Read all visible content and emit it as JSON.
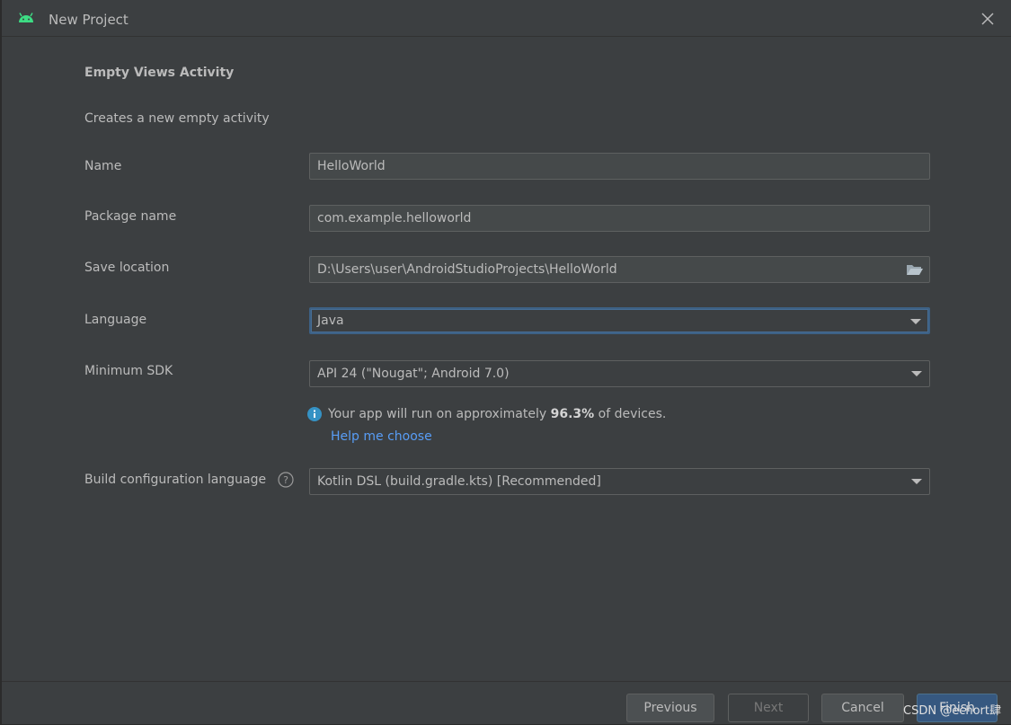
{
  "window": {
    "title": "New Project"
  },
  "template": {
    "heading": "Empty Views Activity",
    "description": "Creates a new empty activity"
  },
  "form": {
    "name": {
      "label": "Name",
      "value": "HelloWorld"
    },
    "package": {
      "label": "Package name",
      "value": "com.example.helloworld"
    },
    "location": {
      "label": "Save location",
      "value": "D:\\Users\\user\\AndroidStudioProjects\\HelloWorld"
    },
    "language": {
      "label": "Language",
      "value": "Java"
    },
    "min_sdk": {
      "label": "Minimum SDK",
      "value": "API 24 (\"Nougat\"; Android 7.0)"
    },
    "build_config": {
      "label": "Build configuration language",
      "value": "Kotlin DSL (build.gradle.kts) [Recommended]"
    }
  },
  "info": {
    "prefix": "Your app will run on approximately ",
    "percent": "96.3%",
    "suffix": " of devices.",
    "help_link": "Help me choose"
  },
  "buttons": {
    "previous": "Previous",
    "next": "Next",
    "cancel": "Cancel",
    "finish": "Finish"
  },
  "watermark": "CSDN @echort肆",
  "colors": {
    "background": "#3c3f41",
    "field": "#45494a",
    "link": "#589df6",
    "info_icon": "#3592c4",
    "android_green": "#3ddc84",
    "focus_border": "#3d6185",
    "primary_button": "#365880"
  },
  "icons": {
    "app": "android-icon",
    "close": "close-icon",
    "folder": "folder-icon",
    "info": "info-icon",
    "help": "question-icon",
    "dropdown": "chevron-down-icon"
  }
}
